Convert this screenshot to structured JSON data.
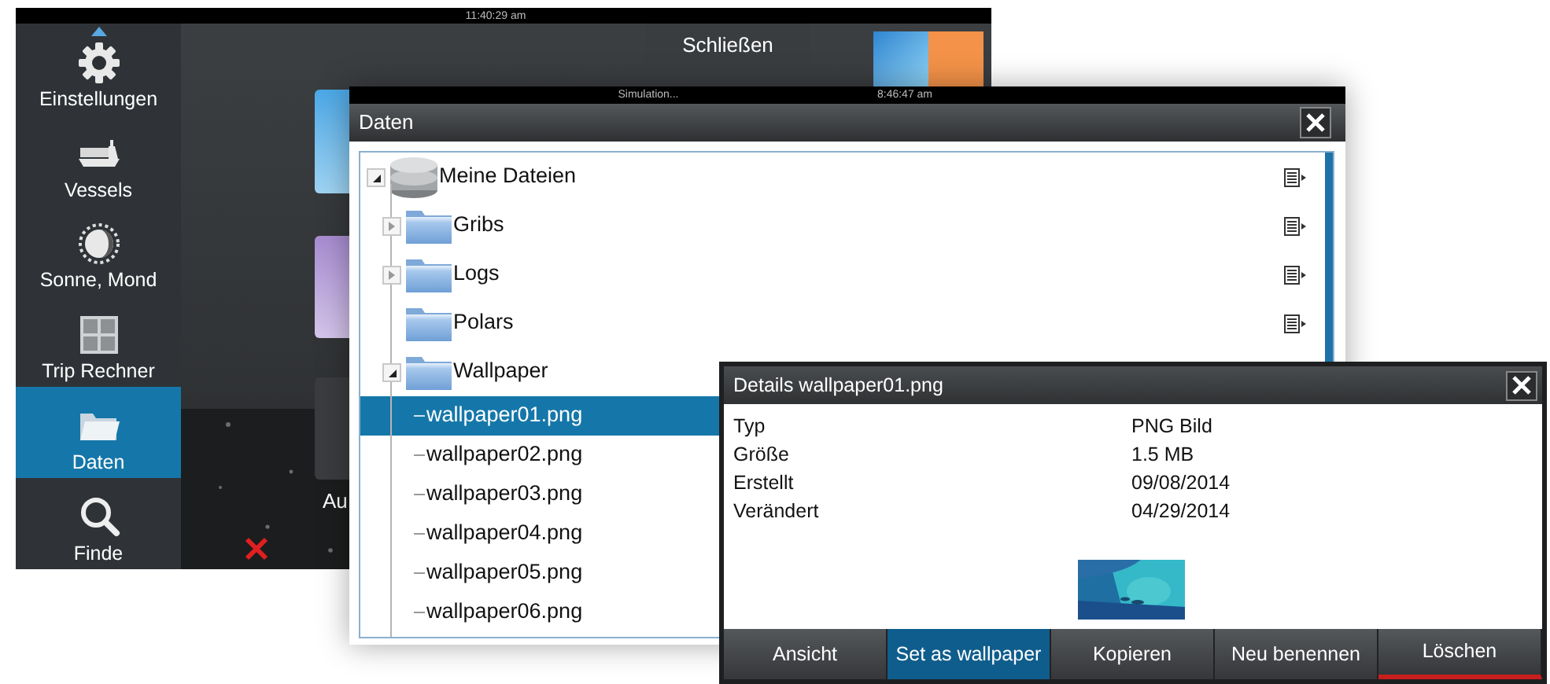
{
  "back_screen": {
    "clock": "11:40:29 am",
    "sidebar": [
      {
        "label": "Einstellungen",
        "kind": "gear",
        "selected": false
      },
      {
        "label": "Vessels",
        "kind": "ship",
        "selected": false
      },
      {
        "label": "Sonne, Mond",
        "kind": "sun-moon",
        "selected": false
      },
      {
        "label": "Trip Rechner",
        "kind": "calculator",
        "selected": false
      },
      {
        "label": "Daten",
        "kind": "folder",
        "selected": true
      },
      {
        "label": "Finde",
        "kind": "search",
        "selected": false
      }
    ],
    "close_button": "Schließen",
    "partial_label": "Au"
  },
  "files_window": {
    "status": "Simulation...",
    "clock": "8:46:47 am",
    "title": "Daten",
    "tree": [
      {
        "label": "Meine Dateien",
        "kind": "drive",
        "expanded": true,
        "menu": true,
        "children": [
          {
            "label": "Gribs",
            "kind": "folder",
            "expanded": false,
            "menu": true
          },
          {
            "label": "Logs",
            "kind": "folder",
            "expanded": false,
            "menu": true
          },
          {
            "label": "Polars",
            "kind": "folder",
            "menu": true
          },
          {
            "label": "Wallpaper",
            "kind": "folder",
            "expanded": true,
            "children": [
              {
                "label": "wallpaper01.png",
                "kind": "file",
                "selected": true
              },
              {
                "label": "wallpaper02.png",
                "kind": "file",
                "selected": false
              },
              {
                "label": "wallpaper03.png",
                "kind": "file",
                "selected": false
              },
              {
                "label": "wallpaper04.png",
                "kind": "file",
                "selected": false
              },
              {
                "label": "wallpaper05.png",
                "kind": "file",
                "selected": false
              },
              {
                "label": "wallpaper06.png",
                "kind": "file",
                "selected": false
              }
            ]
          }
        ]
      }
    ]
  },
  "details": {
    "title": "Details wallpaper01.png",
    "properties": [
      {
        "label": "Typ",
        "value": "PNG Bild"
      },
      {
        "label": "Größe",
        "value": "1.5 MB"
      },
      {
        "label": "Erstellt",
        "value": "09/08/2014"
      },
      {
        "label": "Verändert",
        "value": "04/29/2014"
      }
    ],
    "buttons": [
      {
        "label": "Ansicht",
        "kind": "normal",
        "selected": false
      },
      {
        "label": "Set as wallpaper",
        "kind": "normal",
        "selected": true
      },
      {
        "label": "Kopieren",
        "kind": "normal",
        "selected": false
      },
      {
        "label": "Neu benennen",
        "kind": "normal",
        "selected": false
      },
      {
        "label": "Löschen",
        "kind": "delete",
        "selected": false
      }
    ]
  }
}
